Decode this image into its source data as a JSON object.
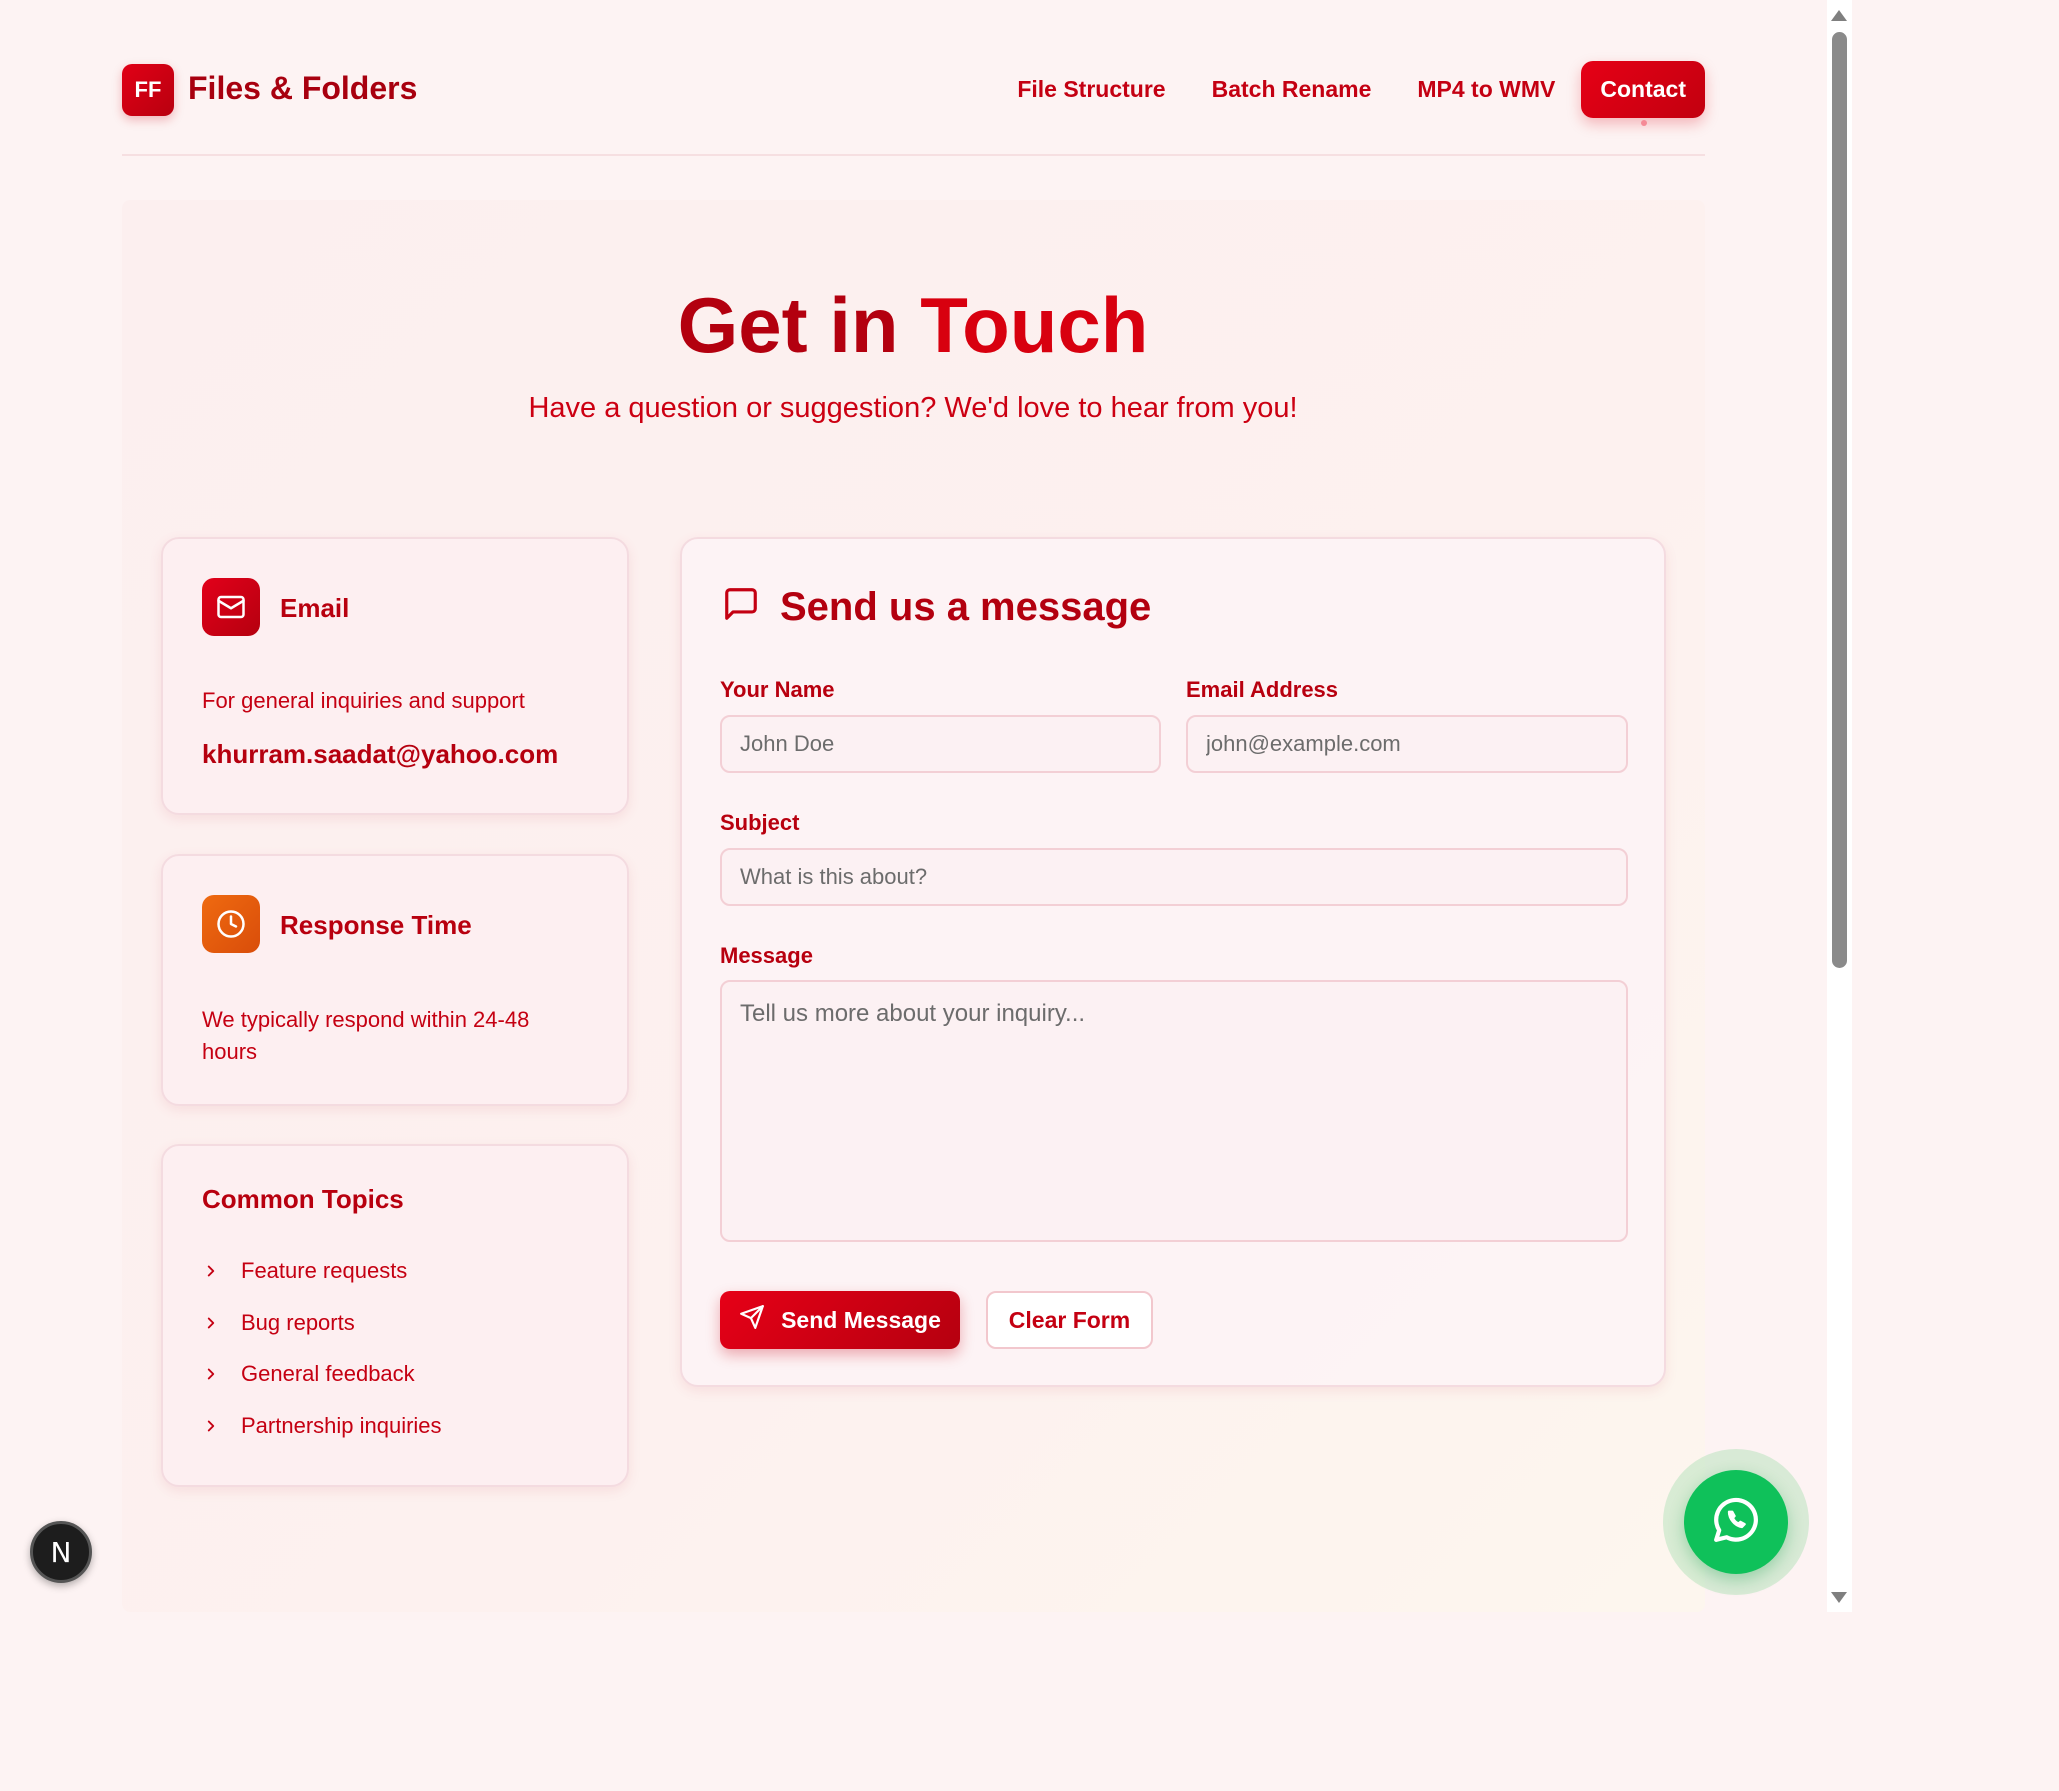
{
  "header": {
    "logo_text": "FF",
    "brand": "Files & Folders",
    "nav": [
      {
        "label": "File Structure"
      },
      {
        "label": "Batch Rename"
      },
      {
        "label": "MP4 to WMV"
      },
      {
        "label": "Contact"
      }
    ]
  },
  "hero": {
    "title_part1": "Get in ",
    "title_part2": "Touch",
    "subtitle": "Have a question or suggestion? We'd love to hear from you!"
  },
  "email_card": {
    "title": "Email",
    "description": "For general inquiries and support",
    "email": "khurram.saadat@yahoo.com"
  },
  "response_card": {
    "title": "Response Time",
    "line1": "We typically respond within 24-48",
    "line2": "hours"
  },
  "topics_card": {
    "title": "Common Topics",
    "items": [
      "Feature requests",
      "Bug reports",
      "General feedback",
      "Partnership inquiries"
    ]
  },
  "form": {
    "title": "Send us a message",
    "name_label": "Your Name",
    "name_placeholder": "John Doe",
    "email_label": "Email Address",
    "email_placeholder": "john@example.com",
    "subject_label": "Subject",
    "subject_placeholder": "What is this about?",
    "message_label": "Message",
    "message_placeholder": "Tell us more about your inquiry...",
    "send_label": "Send Message",
    "clear_label": "Clear Form"
  },
  "badges": {
    "next_letter": "N"
  },
  "colors": {
    "primary": "#c40012",
    "primary_dark": "#b3000f",
    "orange": "#e85c0d",
    "whatsapp": "#0fc15a",
    "page_bg": "#fdf3f3"
  },
  "icons": [
    "mail-icon",
    "clock-icon",
    "chevron-right-icon",
    "message-square-icon",
    "send-icon",
    "whatsapp-icon"
  ]
}
